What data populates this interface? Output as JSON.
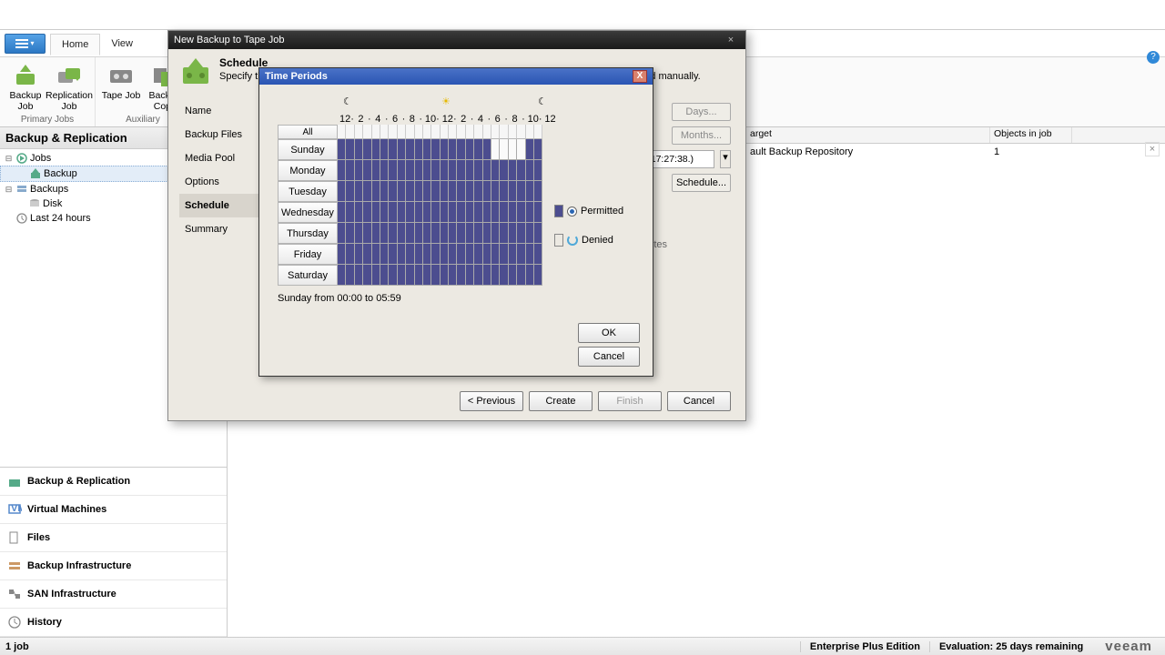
{
  "ribbon": {
    "tabs": {
      "home": "Home",
      "view": "View"
    },
    "buttons": {
      "backup_job": "Backup Job",
      "replication_job": "Replication Job",
      "tape_job": "Tape Job",
      "backup_copy": "Backup Copy"
    },
    "groups": {
      "primary": "Primary Jobs",
      "aux": "Auxiliary"
    }
  },
  "nav": {
    "header": "Backup & Replication",
    "tree": {
      "jobs": "Jobs",
      "backup_job": "Backup",
      "backups": "Backups",
      "disk": "Disk",
      "last24": "Last 24 hours"
    },
    "bottom": {
      "br": "Backup & Replication",
      "vm": "Virtual Machines",
      "files": "Files",
      "bi": "Backup Infrastructure",
      "san": "SAN Infrastructure",
      "hist": "History"
    }
  },
  "grid": {
    "cols": {
      "target": "arget",
      "objects": "Objects in job"
    },
    "row": {
      "target": "ault Backup Repository",
      "objects": "1"
    }
  },
  "status": {
    "jobs": "1 job",
    "edition": "Enterprise Plus Edition",
    "eval": "Evaluation: 25 days remaining",
    "brand": "veeam"
  },
  "wizard": {
    "title": "New Backup to Tape Job",
    "step_title": "Schedule",
    "step_desc": "Specify the job scheduling options. If you do not set the schedule, the job will need to be controlled manually.",
    "steps": {
      "name": "Name",
      "files": "Backup Files",
      "media": "Media Pool",
      "options": "Options",
      "schedule": "Schedule",
      "summary": "Summary"
    },
    "controls": {
      "days": "Days...",
      "months": "Months...",
      "timestamp": "4 17:27:38.)",
      "schedule": "Schedule...",
      "idle_text": "utes"
    },
    "buttons": {
      "prev": "< Previous",
      "create": "Create",
      "finish": "Finish",
      "cancel": "Cancel"
    }
  },
  "time_periods": {
    "title": "Time Periods",
    "all": "All",
    "days": [
      "Sunday",
      "Monday",
      "Tuesday",
      "Wednesday",
      "Thursday",
      "Friday",
      "Saturday"
    ],
    "hours": [
      "12",
      "·",
      "2",
      "·",
      "4",
      "·",
      "6",
      "·",
      "8",
      "·",
      "10",
      "·",
      "12",
      "·",
      "2",
      "·",
      "4",
      "·",
      "6",
      "·",
      "8",
      "·",
      "10",
      "·",
      "12"
    ],
    "legend": {
      "permitted": "Permitted",
      "denied": "Denied"
    },
    "status": "Sunday from 00:00 to 05:59",
    "ok": "OK",
    "cancel": "Cancel",
    "denied_cells": {
      "day": 0,
      "from": 18,
      "to": 22
    }
  }
}
